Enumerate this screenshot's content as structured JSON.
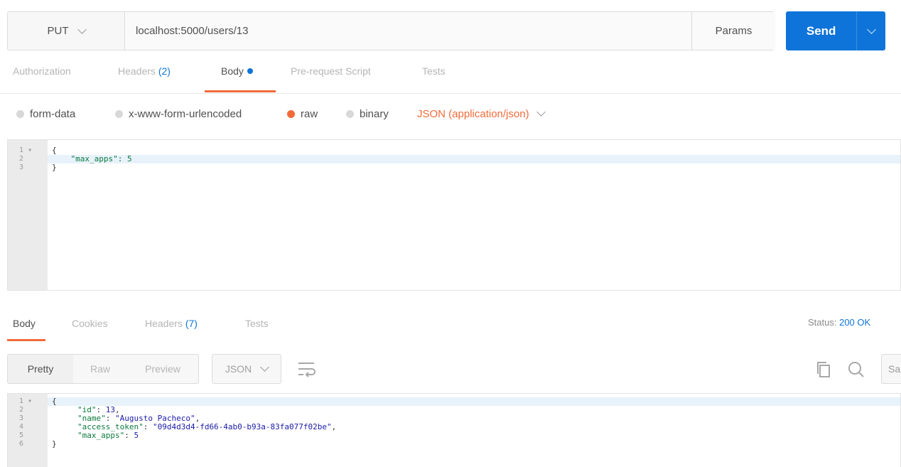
{
  "request": {
    "method": "PUT",
    "url": "localhost:5000/users/13",
    "params_label": "Params",
    "send_label": "Send"
  },
  "request_tabs": [
    {
      "label": "Authorization"
    },
    {
      "label": "Headers",
      "count": "(2)"
    },
    {
      "label": "Body"
    },
    {
      "label": "Pre-request Script"
    },
    {
      "label": "Tests"
    }
  ],
  "body_types": {
    "form_data": "form-data",
    "urlencoded": "x-www-form-urlencoded",
    "raw": "raw",
    "binary": "binary",
    "selected": "raw",
    "content_type": "JSON (application/json)"
  },
  "request_body": {
    "line_numbers": [
      "1",
      "2",
      "3"
    ],
    "lines": [
      "{",
      "    \"max_apps\": 5",
      "}"
    ]
  },
  "response_tabs": [
    {
      "label": "Body"
    },
    {
      "label": "Cookies"
    },
    {
      "label": "Headers",
      "count": "(7)"
    },
    {
      "label": "Tests"
    }
  ],
  "status": {
    "label": "Status:",
    "value": "200 OK"
  },
  "response_toolbar": {
    "views": [
      "Pretty",
      "Raw",
      "Preview"
    ],
    "format": "JSON",
    "save_partial": "Sa"
  },
  "response_body": {
    "line_numbers": [
      "1",
      "2",
      "3",
      "4",
      "5",
      "6"
    ],
    "fields": [
      {
        "key": "\"id\"",
        "value": "13"
      },
      {
        "key": "\"name\"",
        "value": "\"Augusto Pacheco\""
      },
      {
        "key": "\"access_token\"",
        "value": "\"09d4d3d4-fd66-4ab0-b93a-83fa077f02be\""
      },
      {
        "key": "\"max_apps\"",
        "value": "5"
      }
    ]
  },
  "colors": {
    "accent_orange": "#f26b3a",
    "send_blue": "#0f74d9",
    "count_blue": "#0f74d9"
  }
}
